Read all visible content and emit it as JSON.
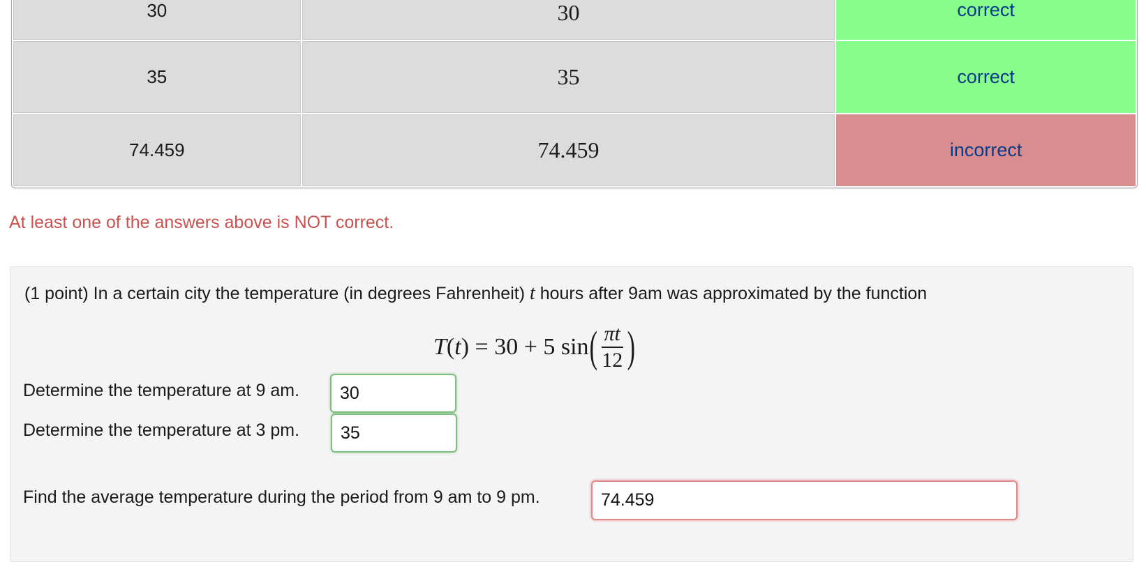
{
  "results": {
    "rows": [
      {
        "entered": "30",
        "preview": "30",
        "status": "correct",
        "state": "ok"
      },
      {
        "entered": "35",
        "preview": "35",
        "status": "correct",
        "state": "ok"
      },
      {
        "entered": "74.459",
        "preview": "74.459",
        "status": "incorrect",
        "state": "bad"
      }
    ]
  },
  "summary_message": "At least one of the answers above is NOT correct.",
  "problem": {
    "intro_before": "(1 point) In a certain city the temperature (in degrees Fahrenheit) ",
    "intro_var": "t",
    "intro_after": " hours after 9am was approximated by the function",
    "formula": {
      "lhs_func": "T",
      "lhs_open": "(",
      "lhs_var": "t",
      "lhs_close": ")",
      "equals": " = 30 + 5 sin",
      "numerator": "πt",
      "denominator": "12"
    },
    "questions": [
      {
        "label": "Determine the temperature at 9 am.",
        "value": "30",
        "state": "correct"
      },
      {
        "label": "Determine the temperature at 3 pm.",
        "value": "35",
        "state": "correct"
      },
      {
        "label": "Find the average temperature during the period from 9 am to 9 pm.",
        "value": "74.459",
        "state": "incorrect"
      }
    ]
  }
}
